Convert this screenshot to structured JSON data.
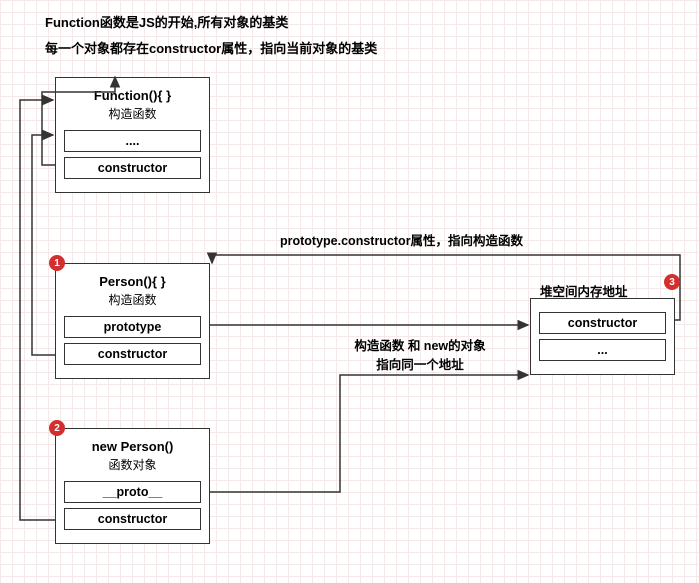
{
  "headers": {
    "line1": "Function函数是JS的开始,所有对象的基类",
    "line2": "每一个对象都存在constructor属性，指向当前对象的基类"
  },
  "boxes": {
    "function": {
      "title": "Function(){  }",
      "subtitle": "构造函数",
      "prop1": "....",
      "prop2": "constructor"
    },
    "person": {
      "badge": "1",
      "title": "Person(){  }",
      "subtitle": "构造函数",
      "prop1": "prototype",
      "prop2": "constructor"
    },
    "newPerson": {
      "badge": "2",
      "title": "new Person()",
      "subtitle": "函数对象",
      "prop1": "__proto__",
      "prop2": "constructor"
    },
    "heap": {
      "badge": "3",
      "title": "堆空间内存地址",
      "prop1": "constructor",
      "prop2": "..."
    }
  },
  "labels": {
    "proto_constructor": "prototype.constructor属性，指向构造函数",
    "same_addr_line1": "构造函数 和 new的对象",
    "same_addr_line2": "指向同一个地址"
  }
}
